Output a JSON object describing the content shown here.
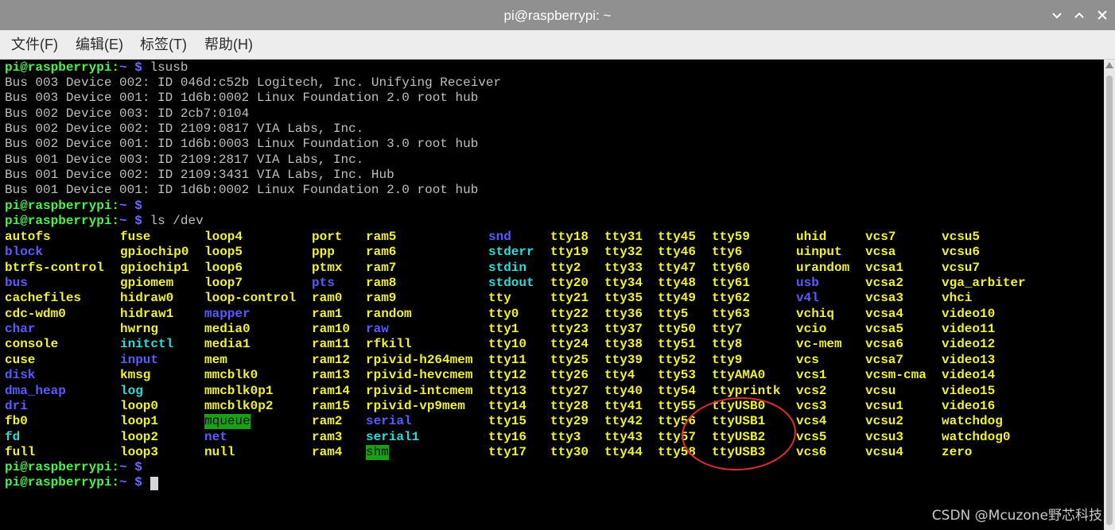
{
  "window": {
    "title": "pi@raspberrypi: ~",
    "controls": [
      "chevron-down-icon",
      "chevron-up-icon",
      "close-icon"
    ]
  },
  "menu": [
    "文件(F)",
    "编辑(E)",
    "标签(T)",
    "帮助(H)"
  ],
  "prompt": {
    "user": "pi@raspberrypi",
    "sep": ":",
    "path": "~",
    "dollar": "$"
  },
  "commands": {
    "first": "lsusb",
    "second": "ls /dev"
  },
  "lsusb_output": [
    "Bus 003 Device 002: ID 046d:c52b Logitech, Inc. Unifying Receiver",
    "Bus 003 Device 001: ID 1d6b:0002 Linux Foundation 2.0 root hub",
    "Bus 002 Device 003: ID 2cb7:0104",
    "Bus 002 Device 002: ID 2109:0817 VIA Labs, Inc.",
    "Bus 002 Device 001: ID 1d6b:0003 Linux Foundation 3.0 root hub",
    "Bus 001 Device 003: ID 2109:2817 VIA Labs, Inc.",
    "Bus 001 Device 002: ID 2109:3431 VIA Labs, Inc. Hub",
    "Bus 001 Device 001: ID 1d6b:0002 Linux Foundation 2.0 root hub"
  ],
  "dev_listing": [
    [
      [
        "autofs",
        "y"
      ],
      [
        "fuse",
        "y"
      ],
      [
        "loop4",
        "y"
      ],
      [
        "port",
        "y"
      ],
      [
        "ram5",
        "y"
      ],
      [
        "snd",
        "b"
      ],
      [
        "tty18",
        "y"
      ],
      [
        "tty31",
        "y"
      ],
      [
        "tty45",
        "y"
      ],
      [
        "tty59",
        "y"
      ],
      [
        "uhid",
        "y"
      ],
      [
        "vcs7",
        "y"
      ],
      [
        "vcsu5",
        "y"
      ]
    ],
    [
      [
        "block",
        "b"
      ],
      [
        "gpiochip0",
        "y"
      ],
      [
        "loop5",
        "y"
      ],
      [
        "ppp",
        "y"
      ],
      [
        "ram6",
        "y"
      ],
      [
        "stderr",
        "c"
      ],
      [
        "tty19",
        "y"
      ],
      [
        "tty32",
        "y"
      ],
      [
        "tty46",
        "y"
      ],
      [
        "tty6",
        "y"
      ],
      [
        "uinput",
        "y"
      ],
      [
        "vcsa",
        "y"
      ],
      [
        "vcsu6",
        "y"
      ]
    ],
    [
      [
        "btrfs-control",
        "y"
      ],
      [
        "gpiochip1",
        "y"
      ],
      [
        "loop6",
        "y"
      ],
      [
        "ptmx",
        "y"
      ],
      [
        "ram7",
        "y"
      ],
      [
        "stdin",
        "c"
      ],
      [
        "tty2",
        "y"
      ],
      [
        "tty33",
        "y"
      ],
      [
        "tty47",
        "y"
      ],
      [
        "tty60",
        "y"
      ],
      [
        "urandom",
        "y"
      ],
      [
        "vcsa1",
        "y"
      ],
      [
        "vcsu7",
        "y"
      ]
    ],
    [
      [
        "bus",
        "b"
      ],
      [
        "gpiomem",
        "y"
      ],
      [
        "loop7",
        "y"
      ],
      [
        "pts",
        "b"
      ],
      [
        "ram8",
        "y"
      ],
      [
        "stdout",
        "c"
      ],
      [
        "tty20",
        "y"
      ],
      [
        "tty34",
        "y"
      ],
      [
        "tty48",
        "y"
      ],
      [
        "tty61",
        "y"
      ],
      [
        "usb",
        "b"
      ],
      [
        "vcsa2",
        "y"
      ],
      [
        "vga_arbiter",
        "y"
      ]
    ],
    [
      [
        "cachefiles",
        "y"
      ],
      [
        "hidraw0",
        "y"
      ],
      [
        "loop-control",
        "y"
      ],
      [
        "ram0",
        "y"
      ],
      [
        "ram9",
        "y"
      ],
      [
        "tty",
        "y"
      ],
      [
        "tty21",
        "y"
      ],
      [
        "tty35",
        "y"
      ],
      [
        "tty49",
        "y"
      ],
      [
        "tty62",
        "y"
      ],
      [
        "v4l",
        "b"
      ],
      [
        "vcsa3",
        "y"
      ],
      [
        "vhci",
        "y"
      ]
    ],
    [
      [
        "cdc-wdm0",
        "y"
      ],
      [
        "hidraw1",
        "y"
      ],
      [
        "mapper",
        "b"
      ],
      [
        "ram1",
        "y"
      ],
      [
        "random",
        "y"
      ],
      [
        "tty0",
        "y"
      ],
      [
        "tty22",
        "y"
      ],
      [
        "tty36",
        "y"
      ],
      [
        "tty5",
        "y"
      ],
      [
        "tty63",
        "y"
      ],
      [
        "vchiq",
        "y"
      ],
      [
        "vcsa4",
        "y"
      ],
      [
        "video10",
        "y"
      ]
    ],
    [
      [
        "char",
        "b"
      ],
      [
        "hwrng",
        "y"
      ],
      [
        "media0",
        "y"
      ],
      [
        "ram10",
        "y"
      ],
      [
        "raw",
        "b"
      ],
      [
        "tty1",
        "y"
      ],
      [
        "tty23",
        "y"
      ],
      [
        "tty37",
        "y"
      ],
      [
        "tty50",
        "y"
      ],
      [
        "tty7",
        "y"
      ],
      [
        "vcio",
        "y"
      ],
      [
        "vcsa5",
        "y"
      ],
      [
        "video11",
        "y"
      ]
    ],
    [
      [
        "console",
        "y"
      ],
      [
        "initctl",
        "c"
      ],
      [
        "media1",
        "y"
      ],
      [
        "ram11",
        "y"
      ],
      [
        "rfkill",
        "y"
      ],
      [
        "tty10",
        "y"
      ],
      [
        "tty24",
        "y"
      ],
      [
        "tty38",
        "y"
      ],
      [
        "tty51",
        "y"
      ],
      [
        "tty8",
        "y"
      ],
      [
        "vc-mem",
        "y"
      ],
      [
        "vcsa6",
        "y"
      ],
      [
        "video12",
        "y"
      ]
    ],
    [
      [
        "cuse",
        "y"
      ],
      [
        "input",
        "b"
      ],
      [
        "mem",
        "y"
      ],
      [
        "ram12",
        "y"
      ],
      [
        "rpivid-h264mem",
        "y"
      ],
      [
        "tty11",
        "y"
      ],
      [
        "tty25",
        "y"
      ],
      [
        "tty39",
        "y"
      ],
      [
        "tty52",
        "y"
      ],
      [
        "tty9",
        "y"
      ],
      [
        "vcs",
        "y"
      ],
      [
        "vcsa7",
        "y"
      ],
      [
        "video13",
        "y"
      ]
    ],
    [
      [
        "disk",
        "b"
      ],
      [
        "kmsg",
        "y"
      ],
      [
        "mmcblk0",
        "y"
      ],
      [
        "ram13",
        "y"
      ],
      [
        "rpivid-hevcmem",
        "y"
      ],
      [
        "tty12",
        "y"
      ],
      [
        "tty26",
        "y"
      ],
      [
        "tty4",
        "y"
      ],
      [
        "tty53",
        "y"
      ],
      [
        "ttyAMA0",
        "y"
      ],
      [
        "vcs1",
        "y"
      ],
      [
        "vcsm-cma",
        "y"
      ],
      [
        "video14",
        "y"
      ]
    ],
    [
      [
        "dma_heap",
        "b"
      ],
      [
        "log",
        "c"
      ],
      [
        "mmcblk0p1",
        "y"
      ],
      [
        "ram14",
        "y"
      ],
      [
        "rpivid-intcmem",
        "y"
      ],
      [
        "tty13",
        "y"
      ],
      [
        "tty27",
        "y"
      ],
      [
        "tty40",
        "y"
      ],
      [
        "tty54",
        "y"
      ],
      [
        "ttyprintk",
        "y"
      ],
      [
        "vcs2",
        "y"
      ],
      [
        "vcsu",
        "y"
      ],
      [
        "video15",
        "y"
      ]
    ],
    [
      [
        "dri",
        "b"
      ],
      [
        "loop0",
        "y"
      ],
      [
        "mmcblk0p2",
        "y"
      ],
      [
        "ram15",
        "y"
      ],
      [
        "rpivid-vp9mem",
        "y"
      ],
      [
        "tty14",
        "y"
      ],
      [
        "tty28",
        "y"
      ],
      [
        "tty41",
        "y"
      ],
      [
        "tty55",
        "y"
      ],
      [
        "ttyUSB0",
        "y"
      ],
      [
        "vcs3",
        "y"
      ],
      [
        "vcsu1",
        "y"
      ],
      [
        "video16",
        "y"
      ]
    ],
    [
      [
        "fb0",
        "y"
      ],
      [
        "loop1",
        "y"
      ],
      [
        "mqueue",
        "g"
      ],
      [
        "ram2",
        "y"
      ],
      [
        "serial",
        "b"
      ],
      [
        "tty15",
        "y"
      ],
      [
        "tty29",
        "y"
      ],
      [
        "tty42",
        "y"
      ],
      [
        "tty56",
        "y"
      ],
      [
        "ttyUSB1",
        "y"
      ],
      [
        "vcs4",
        "y"
      ],
      [
        "vcsu2",
        "y"
      ],
      [
        "watchdog",
        "y"
      ]
    ],
    [
      [
        "fd",
        "c"
      ],
      [
        "loop2",
        "y"
      ],
      [
        "net",
        "b"
      ],
      [
        "ram3",
        "y"
      ],
      [
        "serial1",
        "c"
      ],
      [
        "tty16",
        "y"
      ],
      [
        "tty3",
        "y"
      ],
      [
        "tty43",
        "y"
      ],
      [
        "tty57",
        "y"
      ],
      [
        "ttyUSB2",
        "y"
      ],
      [
        "vcs5",
        "y"
      ],
      [
        "vcsu3",
        "y"
      ],
      [
        "watchdog0",
        "y"
      ]
    ],
    [
      [
        "full",
        "y"
      ],
      [
        "loop3",
        "y"
      ],
      [
        "null",
        "y"
      ],
      [
        "ram4",
        "y"
      ],
      [
        "shm",
        "g"
      ],
      [
        "tty17",
        "y"
      ],
      [
        "tty30",
        "y"
      ],
      [
        "tty44",
        "y"
      ],
      [
        "tty58",
        "y"
      ],
      [
        "ttyUSB3",
        "y"
      ],
      [
        "vcs6",
        "y"
      ],
      [
        "vcsu4",
        "y"
      ],
      [
        "zero",
        "y"
      ]
    ]
  ],
  "colors": {
    "prompt_user": "#4ef24e",
    "prompt_path": "#6a6aff",
    "file": "#f0f037",
    "directory": "#5a5aff",
    "symlink": "#31d8d8",
    "sticky_dir_bg": "#18a018",
    "annotation_circle": "#d9302c"
  },
  "watermark": "CSDN @Mcuzone野芯科技"
}
